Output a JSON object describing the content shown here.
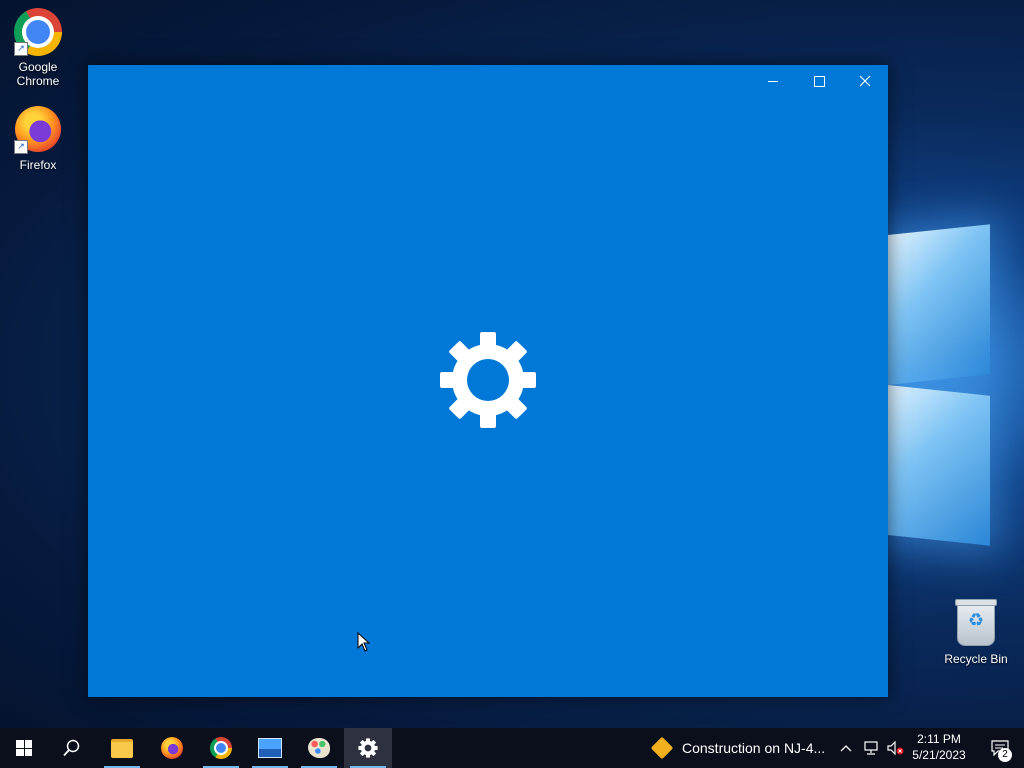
{
  "desktop": {
    "icons": [
      {
        "label": "Google\nChrome",
        "icon": "chrome-icon"
      },
      {
        "label": "Firefox",
        "icon": "firefox-icon"
      },
      {
        "label": "Recycle Bin",
        "icon": "recycle-bin-icon"
      }
    ]
  },
  "window": {
    "app": "Settings",
    "splash_icon": "gear-icon",
    "background_color": "#0078d7",
    "controls": {
      "minimize": "minimize-icon",
      "maximize": "maximize-icon",
      "close": "close-icon"
    }
  },
  "taskbar": {
    "apps": [
      {
        "name": "File Explorer",
        "icon": "folder-icon",
        "running": true
      },
      {
        "name": "Firefox",
        "icon": "firefox-icon",
        "running": false
      },
      {
        "name": "Google Chrome",
        "icon": "chrome-icon",
        "running": true
      },
      {
        "name": "Photos",
        "icon": "photos-icon",
        "running": true
      },
      {
        "name": "Paint",
        "icon": "paint-icon",
        "running": true
      },
      {
        "name": "Settings",
        "icon": "gear-icon",
        "running": true,
        "selected": true
      }
    ],
    "news": {
      "text": "Construction on NJ-4..."
    },
    "tray": {
      "show_hidden": "^"
    },
    "clock": {
      "time": "2:11 PM",
      "date": "5/21/2023"
    },
    "notifications": {
      "count": "2"
    }
  }
}
